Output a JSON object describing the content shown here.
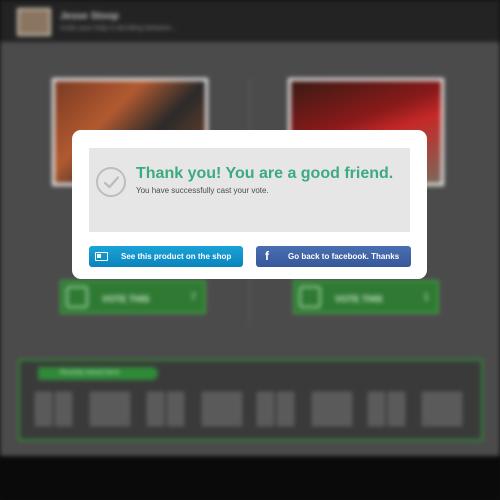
{
  "header": {
    "user_name": "Jesse Stoop",
    "user_subtitle": "Invite your help in deciding between..."
  },
  "products": [
    {
      "vote_label": "VOTE THIS",
      "vote_count": "7"
    },
    {
      "vote_label": "VOTE THIS",
      "vote_count": "1"
    }
  ],
  "recent": {
    "tab_label": "Recently viewed items"
  },
  "modal": {
    "title": "Thank you! You are a good friend.",
    "subtitle": "You have successfully cast your vote.",
    "shop_button": "See this product on the shop",
    "facebook_button": "Go back to facebook. Thanks",
    "facebook_glyph": "f"
  },
  "colors": {
    "accent_green": "#3bab80",
    "shop_button_blue": "#0a84bd",
    "facebook_button_blue": "#36589a",
    "vote_green": "#2f7a33"
  }
}
